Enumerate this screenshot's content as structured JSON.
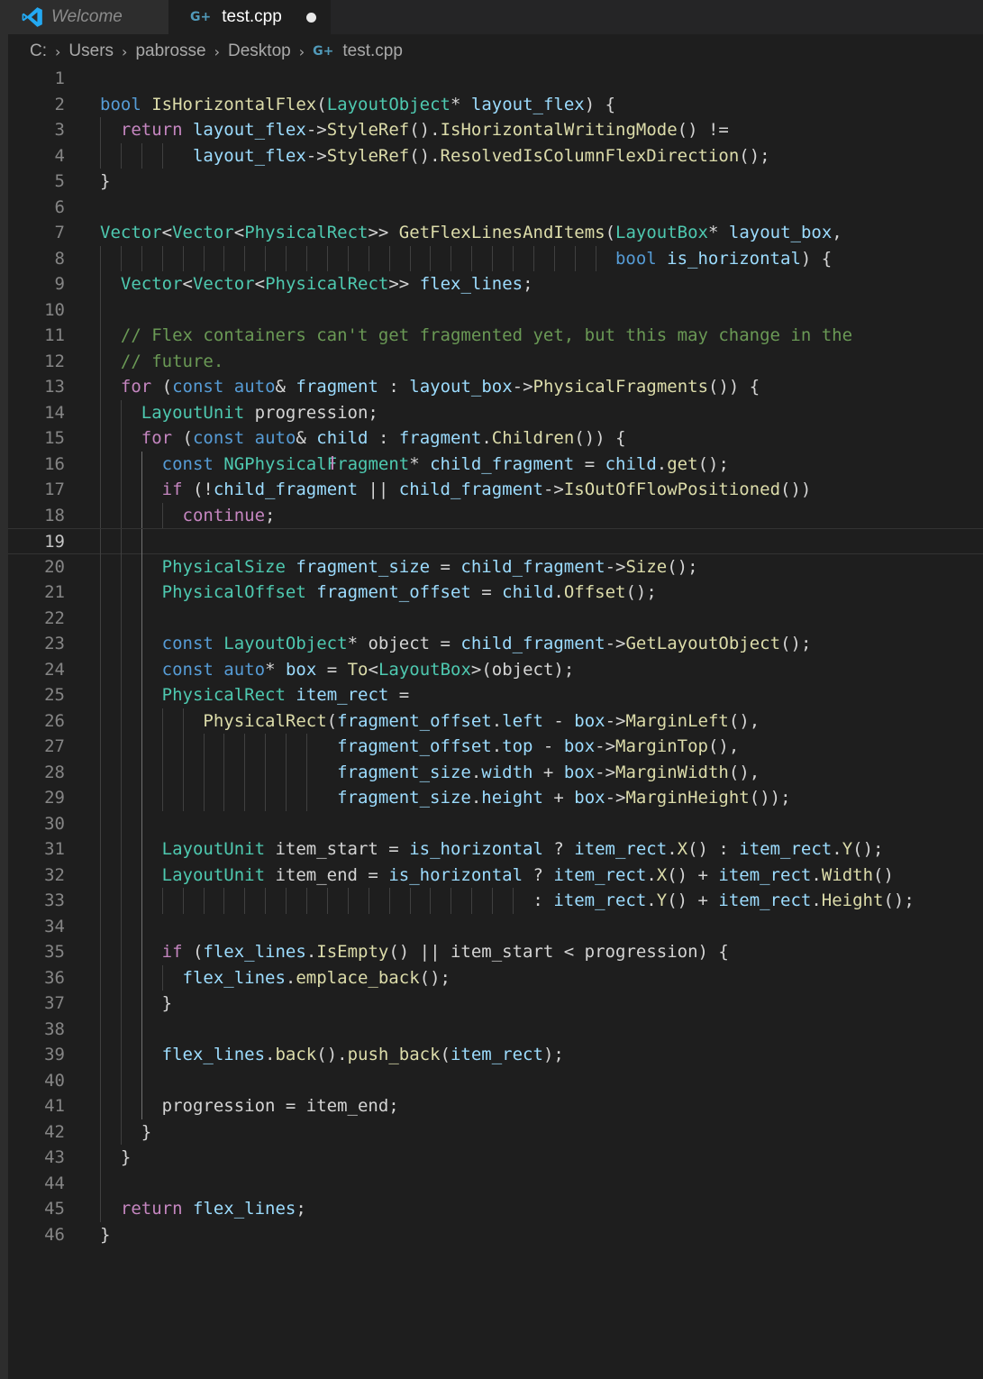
{
  "tabs": {
    "welcome_label": "Welcome",
    "test_label": "test.cpp",
    "test_modified": true
  },
  "breadcrumb": {
    "items": [
      "C:",
      "Users",
      "pabrosse",
      "Desktop",
      "test.cpp"
    ]
  },
  "editor": {
    "current_line": 19,
    "lines": [
      "",
      "bool IsHorizontalFlex(LayoutObject* layout_flex) {",
      "  return layout_flex->StyleRef().IsHorizontalWritingMode() !=",
      "         layout_flex->StyleRef().ResolvedIsColumnFlexDirection();",
      "}",
      "",
      "Vector<Vector<PhysicalRect>> GetFlexLinesAndItems(LayoutBox* layout_box,",
      "                                                  bool is_horizontal) {",
      "  Vector<Vector<PhysicalRect>> flex_lines;",
      "",
      "  // Flex containers can't get fragmented yet, but this may change in the",
      "  // future.",
      "  for (const auto& fragment : layout_box->PhysicalFragments()) {",
      "    LayoutUnit progression;",
      "    for (const auto& child : fragment.Children()) {",
      "      const NGPhysicalFragment* child_fragment = child.get();",
      "      if (!child_fragment || child_fragment->IsOutOfFlowPositioned())",
      "        continue;",
      "",
      "      PhysicalSize fragment_size = child_fragment->Size();",
      "      PhysicalOffset fragment_offset = child.Offset();",
      "",
      "      const LayoutObject* object = child_fragment->GetLayoutObject();",
      "      const auto* box = To<LayoutBox>(object);",
      "      PhysicalRect item_rect =",
      "          PhysicalRect(fragment_offset.left - box->MarginLeft(),",
      "                       fragment_offset.top - box->MarginTop(),",
      "                       fragment_size.width + box->MarginWidth(),",
      "                       fragment_size.height + box->MarginHeight());",
      "",
      "      LayoutUnit item_start = is_horizontal ? item_rect.X() : item_rect.Y();",
      "      LayoutUnit item_end = is_horizontal ? item_rect.X() + item_rect.Width()",
      "                                          : item_rect.Y() + item_rect.Height();",
      "",
      "      if (flex_lines.IsEmpty() || item_start < progression) {",
      "        flex_lines.emplace_back();",
      "      }",
      "",
      "      flex_lines.back().push_back(item_rect);",
      "",
      "      progression = item_end;",
      "    }",
      "  }",
      "",
      "  return flex_lines;",
      "}"
    ]
  }
}
